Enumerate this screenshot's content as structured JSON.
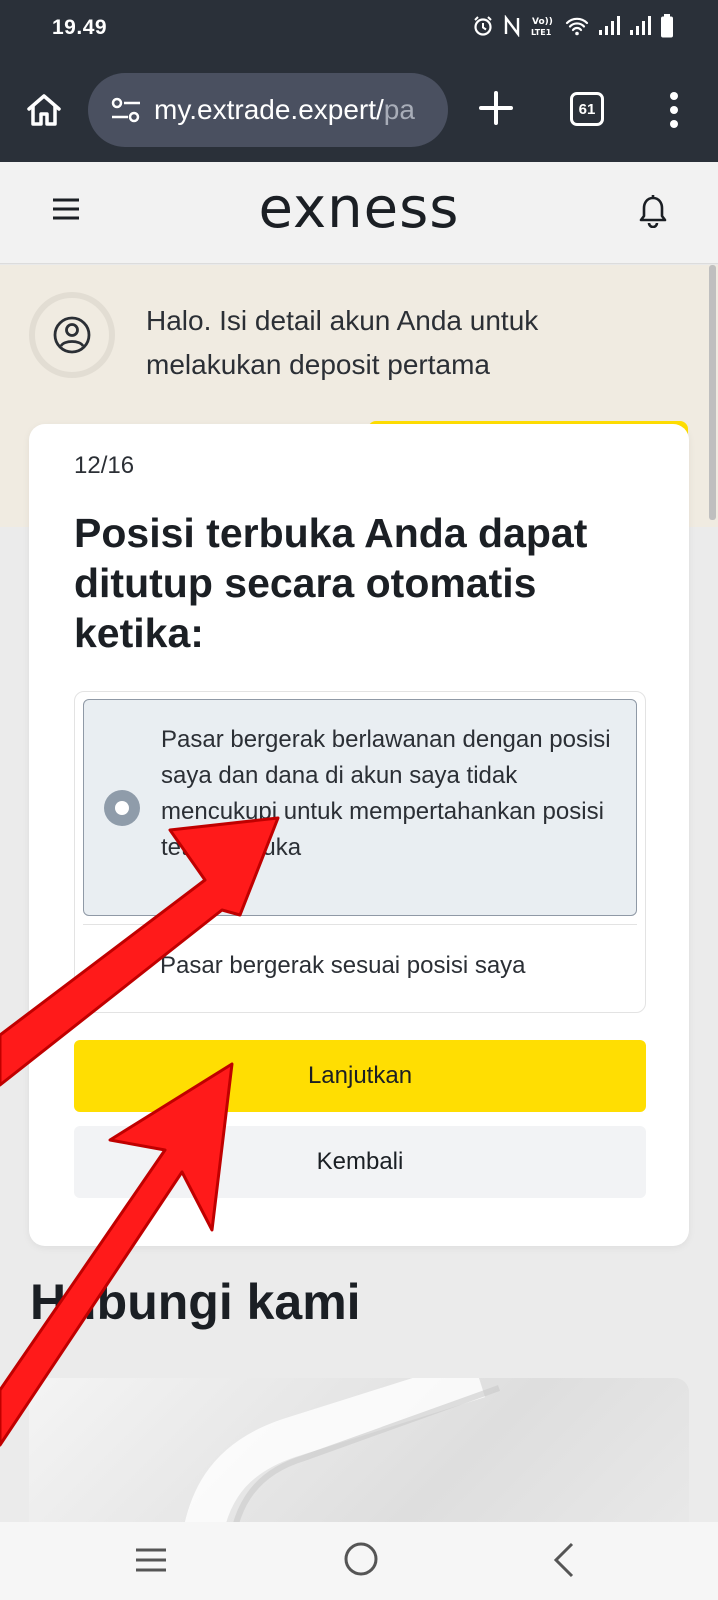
{
  "status_bar": {
    "time": "19.49",
    "icons": [
      "alarm-icon",
      "nfc-icon",
      "volte-icon",
      "wifi-icon",
      "signal-icon",
      "signal-icon",
      "battery-icon"
    ],
    "volte_label": "Vo)) LTE1"
  },
  "browser": {
    "url_visible": "my.extrade.expert/",
    "url_faded": "pa",
    "tab_count": "61",
    "icons": [
      "home-icon",
      "tune-icon",
      "plus-icon",
      "tabs-icon",
      "more-vert-icon"
    ]
  },
  "site_header": {
    "logo": "exness",
    "icons": [
      "hamburger-menu-icon",
      "bell-icon"
    ]
  },
  "banner": {
    "text": "Halo. Isi detail akun Anda untuk melakukan deposit pertama",
    "icon": "user-icon"
  },
  "modal": {
    "step": "12/16",
    "question": "Posisi terbuka Anda dapat ditutup secara otomatis ketika:",
    "options": [
      {
        "label": "Pasar bergerak berlawanan dengan posisi saya dan dana di akun saya tidak mencukupi untuk mempertahankan posisi tetap terbuka",
        "selected": true
      },
      {
        "label": "Pasar bergerak sesuai posisi saya",
        "selected": false
      }
    ],
    "continue_label": "Lanjutkan",
    "back_label": "Kembali"
  },
  "contact": {
    "title": "Hubungi kami"
  },
  "nav_bar": {
    "icons": [
      "recent-apps-icon",
      "home-circle-icon",
      "back-icon"
    ]
  },
  "colors": {
    "accent": "#ffde02",
    "dark_bar": "#2a3039",
    "arrow": "#ff0000"
  }
}
